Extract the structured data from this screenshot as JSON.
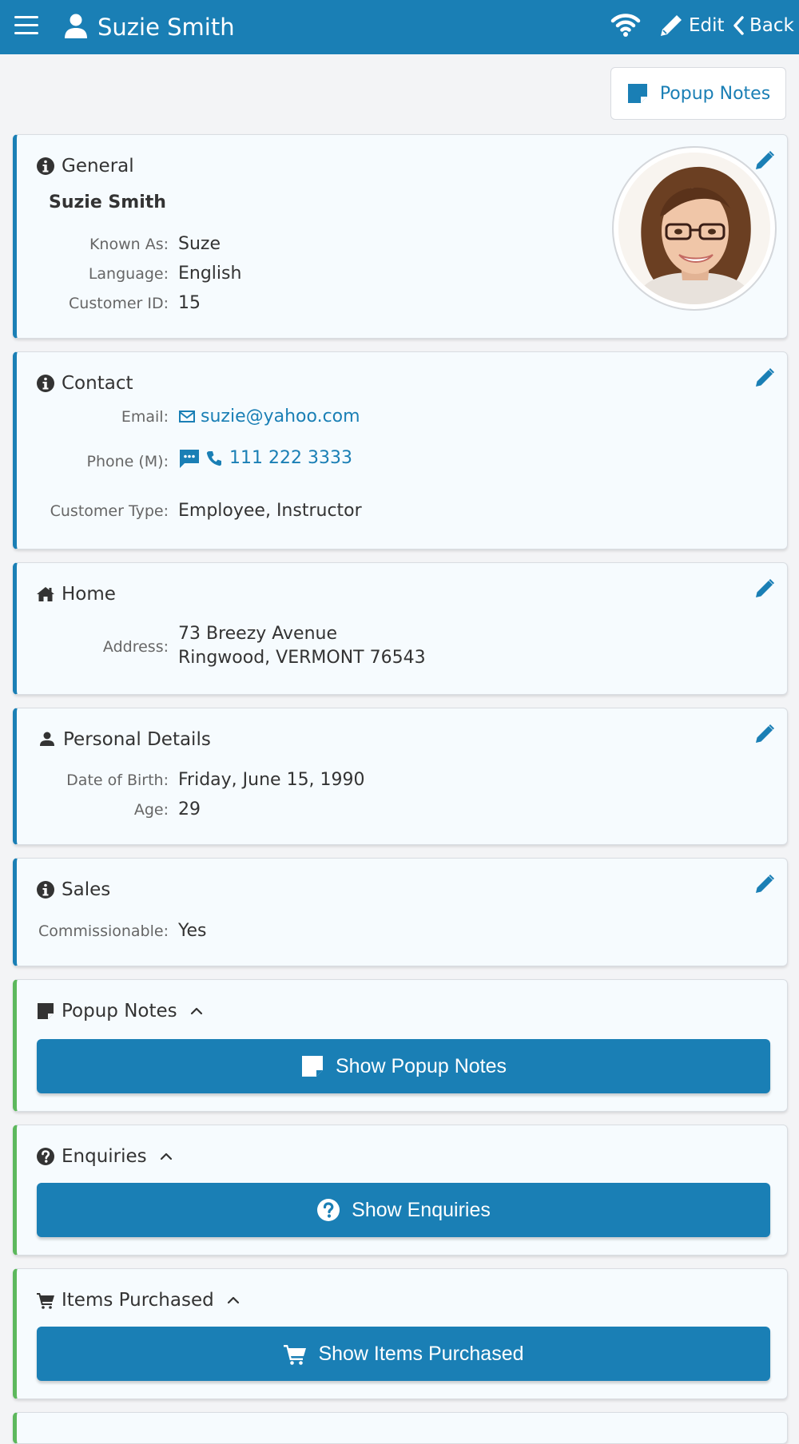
{
  "header": {
    "title": "Suzie Smith",
    "edit_label": "Edit",
    "back_label": "Back"
  },
  "notes_button": {
    "label": "Popup Notes"
  },
  "general": {
    "heading": "General",
    "full_name": "Suzie Smith",
    "fields": [
      {
        "label": "Known As:",
        "value": "Suze"
      },
      {
        "label": "Language:",
        "value": "English"
      },
      {
        "label": "Customer ID:",
        "value": "15"
      }
    ]
  },
  "contact": {
    "heading": "Contact",
    "email_label": "Email:",
    "email": "suzie@yahoo.com",
    "phone_label": "Phone (M):",
    "phone": "111 222 3333",
    "type_label": "Customer Type:",
    "type": "Employee, Instructor"
  },
  "home": {
    "heading": "Home",
    "address_label": "Address:",
    "address_line1": "73 Breezy Avenue",
    "address_line2": "Ringwood, VERMONT 76543"
  },
  "personal": {
    "heading": "Personal Details",
    "dob_label": "Date of Birth:",
    "dob": "Friday, June 15, 1990",
    "age_label": "Age:",
    "age": "29"
  },
  "sales": {
    "heading": "Sales",
    "commission_label": "Commissionable:",
    "commission": "Yes"
  },
  "popup_notes": {
    "heading": "Popup Notes",
    "button": "Show Popup Notes"
  },
  "enquiries": {
    "heading": "Enquiries",
    "button": "Show Enquiries"
  },
  "items_purchased": {
    "heading": "Items Purchased",
    "button": "Show Items Purchased"
  },
  "colors": {
    "primary": "#1a7fb5",
    "accent_green": "#5cb85c",
    "background": "#f3f4f6"
  },
  "icons": {
    "menu": "menu-icon",
    "user": "user-icon",
    "wifi": "wifi-icon",
    "edit": "pencil-icon",
    "back": "chevron-left-icon",
    "note": "sticky-note-icon",
    "info": "info-circle-icon",
    "home": "home-icon",
    "question": "question-circle-icon",
    "cart": "cart-icon"
  }
}
